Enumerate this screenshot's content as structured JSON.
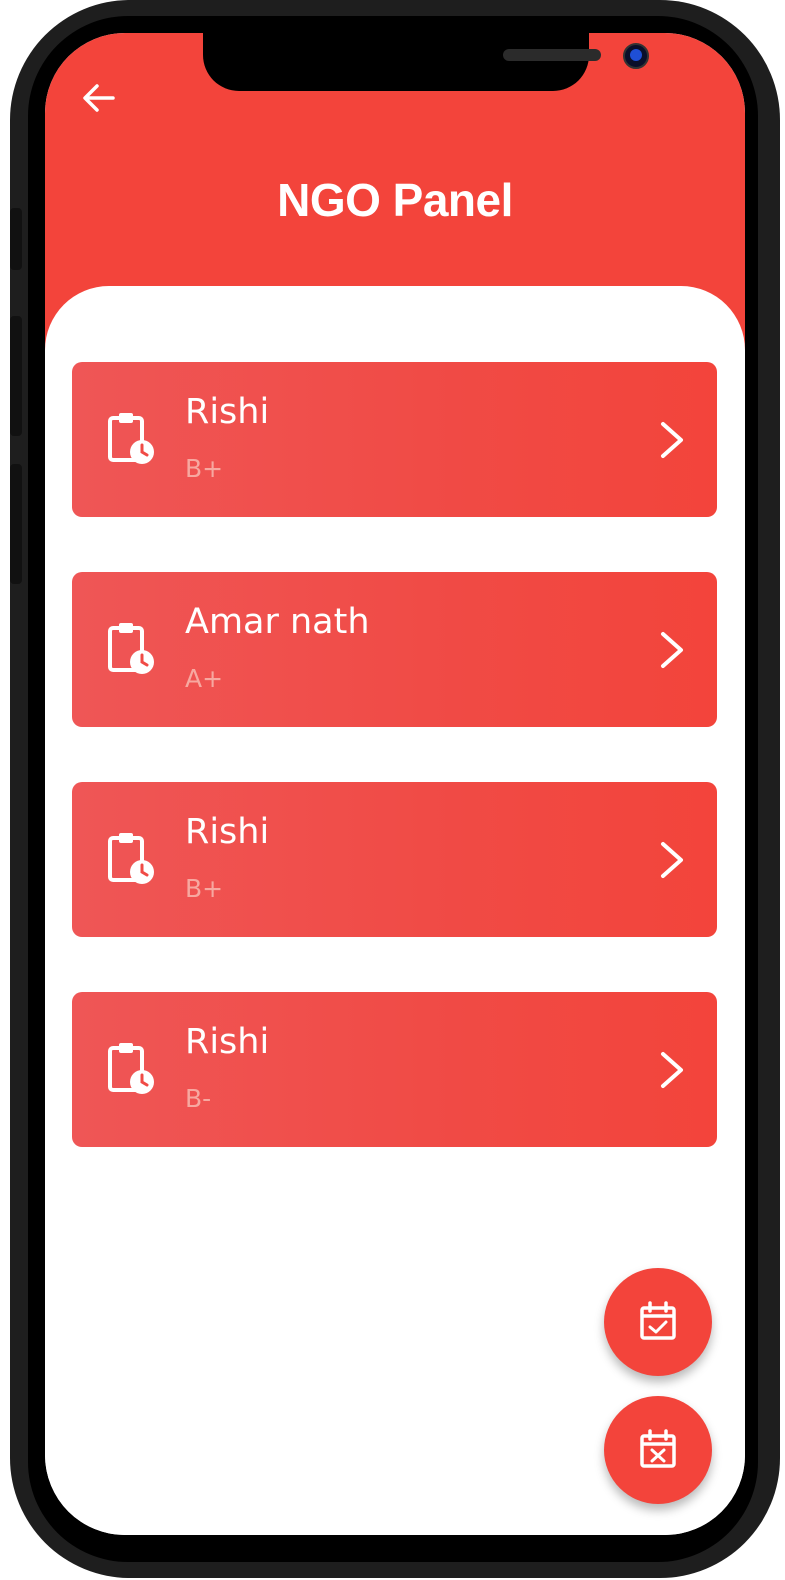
{
  "header": {
    "title": "NGO Panel",
    "back_icon": "arrow-left-icon",
    "background_color": "#f3443b"
  },
  "list": {
    "items": [
      {
        "name": "Rishi",
        "blood_group": "B+",
        "icon": "clipboard-clock-icon"
      },
      {
        "name": "Amar nath",
        "blood_group": "A+",
        "icon": "clipboard-clock-icon"
      },
      {
        "name": "Rishi",
        "blood_group": "B+",
        "icon": "clipboard-clock-icon"
      },
      {
        "name": "Rishi",
        "blood_group": "B-",
        "icon": "clipboard-clock-icon"
      }
    ],
    "chevron_icon": "chevron-right-icon",
    "card_gradient": [
      "#ef5656",
      "#f3443b"
    ],
    "subtitle_color": "#f7a8a0"
  },
  "fabs": {
    "accept_icon": "calendar-check-icon",
    "reject_icon": "calendar-x-icon"
  }
}
